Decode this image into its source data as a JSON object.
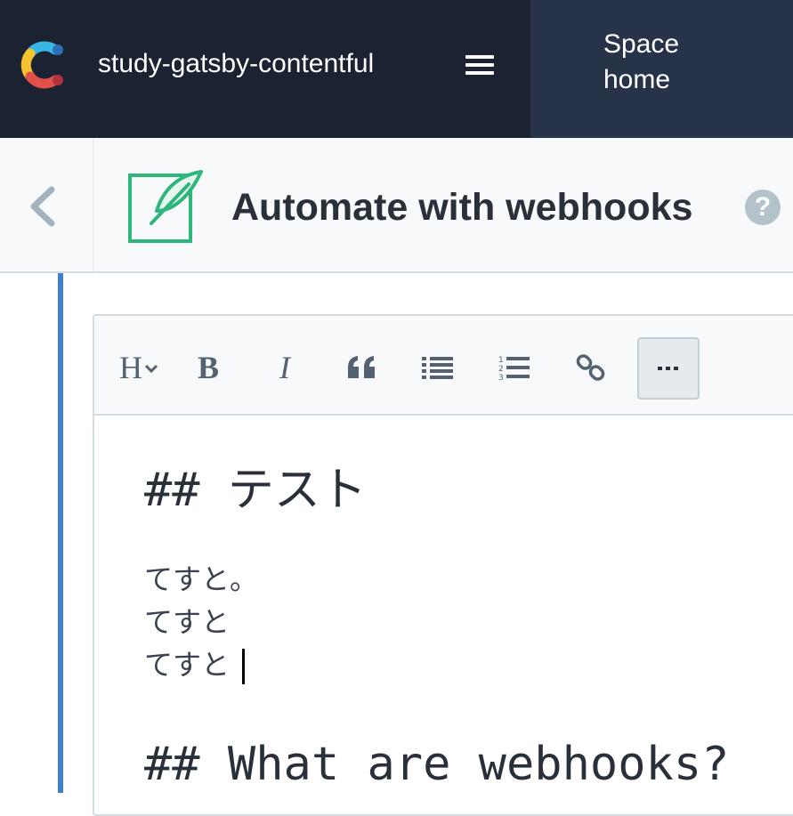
{
  "topbar": {
    "space_name": "study-gatsby-contentful",
    "menu_icon": "hamburger-icon",
    "space_home_label": "Space home"
  },
  "entry": {
    "back_icon": "chevron-left-icon",
    "entry_icon": "feather-entry-icon",
    "title": "Automate with webhooks",
    "help_label": "?"
  },
  "toolbar": {
    "heading_label": "H",
    "bold_label": "B",
    "italic_label": "I",
    "quote_icon": "quote-icon",
    "bullet_list_icon": "unordered-list-icon",
    "numbered_list_icon": "ordered-list-icon",
    "link_icon": "link-icon",
    "more_icon": "more-icon"
  },
  "editor": {
    "heading1": "## テスト",
    "lines": [
      "てすと。",
      "てすと",
      "てすと"
    ],
    "heading2": "## What are webhooks?"
  },
  "colors": {
    "topbar_bg": "#1b2333",
    "space_home_bg": "#273348",
    "header_bg": "#f7f9fa",
    "accent_blue": "#3c80cf",
    "entry_icon_green": "#2fb67c"
  }
}
